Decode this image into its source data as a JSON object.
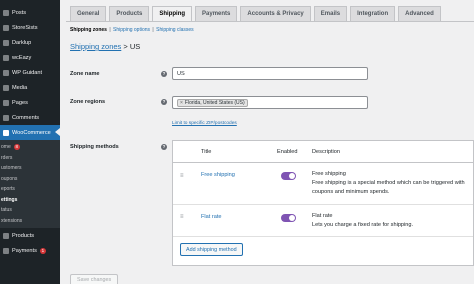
{
  "sidebar": {
    "items_top": [
      {
        "label": "Posts",
        "icon": "pushpin-icon"
      },
      {
        "label": "StoreSists",
        "icon": "store-icon"
      },
      {
        "label": "Darklup",
        "icon": "moon-icon"
      },
      {
        "label": "wcEazy",
        "icon": "gear-icon"
      },
      {
        "label": "WP Guidant",
        "icon": "compass-icon"
      },
      {
        "label": "Media",
        "icon": "media-icon"
      },
      {
        "label": "Pages",
        "icon": "page-icon"
      },
      {
        "label": "Comments",
        "icon": "comment-icon"
      }
    ],
    "woocommerce": {
      "label": "WooCommerce",
      "icon": "woo-icon"
    },
    "submenu": {
      "home": "ome",
      "home_badge": "8",
      "orders": "rders",
      "customers": "ustomers",
      "coupons": "oupons",
      "reports": "eports",
      "settings": "ettings",
      "status": "tatus",
      "extensions": "xtensions"
    },
    "items_bottom": [
      {
        "label": "Products",
        "icon": "box-icon"
      },
      {
        "label": "Payments",
        "icon": "card-icon",
        "badge": "1"
      }
    ]
  },
  "tabs": [
    "General",
    "Products",
    "Shipping",
    "Payments",
    "Accounts & Privacy",
    "Emails",
    "Integration",
    "Advanced"
  ],
  "active_tab": "Shipping",
  "sections": {
    "current": "Shipping zones",
    "sep": "|",
    "options": "Shipping options",
    "classes": "Shipping classes"
  },
  "heading": {
    "link": "Shipping zones",
    "separator": " > ",
    "zone": "US"
  },
  "zone_name": {
    "label": "Zone name",
    "value": "US"
  },
  "zone_regions": {
    "label": "Zone regions",
    "chip": "Florida, United States (US)",
    "limit_link": "Limit to specific ZIP/postcodes"
  },
  "shipping_methods": {
    "label": "Shipping methods",
    "columns": {
      "title": "Title",
      "enabled": "Enabled",
      "description": "Description"
    },
    "rows": [
      {
        "title": "Free shipping",
        "enabled": true,
        "desc_title": "Free shipping",
        "desc_text": "Free shipping is a special method which can be triggered with coupons and minimum spends."
      },
      {
        "title": "Flat rate",
        "enabled": true,
        "desc_title": "Flat rate",
        "desc_text": "Lets you charge a fixed rate for shipping."
      }
    ],
    "add_button": "Add shipping method"
  },
  "save_button": "Save changes",
  "colors": {
    "sidebar": "#1d2327",
    "accent": "#2271b1",
    "toggle": "#7f54b3",
    "badge": "#d63638"
  }
}
